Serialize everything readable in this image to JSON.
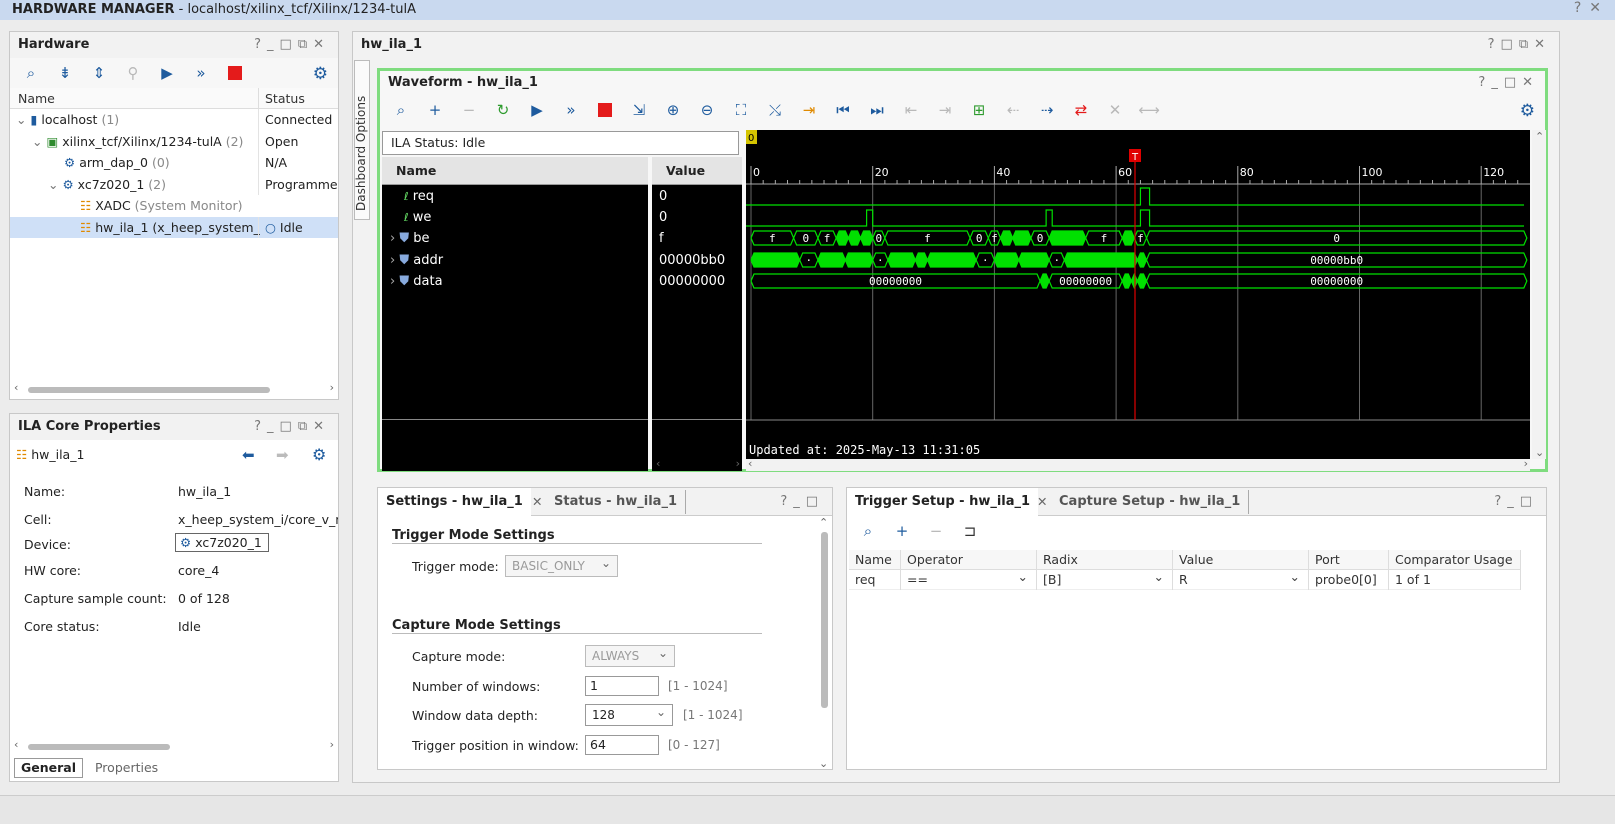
{
  "title": {
    "app": "HARDWARE MANAGER",
    "path": "localhost/xilinx_tcf/Xilinx/1234-tulA"
  },
  "hardware": {
    "title": "Hardware",
    "col_name": "Name",
    "col_status": "Status",
    "rows": [
      {
        "label": "localhost",
        "sub": "(1)",
        "status": "Connected"
      },
      {
        "label": "xilinx_tcf/Xilinx/1234-tulA",
        "sub": "(2)",
        "status": "Open"
      },
      {
        "label": "arm_dap_0",
        "sub": "(0)",
        "status": "N/A"
      },
      {
        "label": "xc7z020_1",
        "sub": "(2)",
        "status": "Programmec"
      },
      {
        "label": "XADC",
        "sub": "(System Monitor)",
        "status": ""
      },
      {
        "label": "hw_ila_1",
        "sub": "(x_heep_system_",
        "status": "Idle"
      }
    ]
  },
  "ila_props": {
    "title": "ILA Core Properties",
    "object": "hw_ila_1",
    "props": [
      {
        "k": "Name:",
        "v": "hw_ila_1"
      },
      {
        "k": "Cell:",
        "v": "x_heep_system_i/core_v_m"
      },
      {
        "k": "Device:",
        "v": "xc7z020_1"
      },
      {
        "k": "HW core:",
        "v": "core_4"
      },
      {
        "k": "Capture sample count:",
        "v": "0 of 128"
      },
      {
        "k": "Core status:",
        "v": "Idle"
      }
    ],
    "tabs": [
      "General",
      "Properties"
    ]
  },
  "main": {
    "title": "hw_ila_1",
    "side_tab": "Dashboard Options",
    "waveform": {
      "title": "Waveform - hw_ila_1",
      "ila_status": "ILA Status:  Idle",
      "col_name": "Name",
      "col_value": "Value",
      "signals": [
        {
          "name": "req",
          "value": "0"
        },
        {
          "name": "we",
          "value": "0"
        },
        {
          "name": "be",
          "value": "f"
        },
        {
          "name": "addr",
          "value": "00000bb0"
        },
        {
          "name": "data",
          "value": "00000000"
        }
      ],
      "ruler": [
        "0",
        "20",
        "40",
        "60",
        "80",
        "100",
        "120"
      ],
      "cursor_label": "T",
      "marker0": "0",
      "bus_be": [
        "f",
        "0",
        "f",
        "0",
        "f",
        "0",
        "f",
        "0",
        "f",
        "f",
        "0"
      ],
      "bus_addr": [
        "00000bb0"
      ],
      "bus_data": [
        "00000000",
        "00000000",
        "00000000"
      ],
      "updated": "Updated at: 2025-May-13 11:31:05"
    },
    "settings": {
      "tabs": [
        "Settings - hw_ila_1",
        "Status - hw_ila_1"
      ],
      "trigger_header": "Trigger Mode Settings",
      "trigger_mode_label": "Trigger mode:",
      "trigger_mode": "BASIC_ONLY",
      "capture_header": "Capture Mode Settings",
      "capture_mode_label": "Capture mode:",
      "capture_mode": "ALWAYS",
      "windows_label": "Number of windows:",
      "windows": "1",
      "windows_range": "[1 - 1024]",
      "depth_label": "Window data depth:",
      "depth": "128",
      "depth_range": "[1 - 1024]",
      "trigpos_label": "Trigger position in window:",
      "trigpos": "64",
      "trigpos_range": "[0 - 127]"
    },
    "trigger": {
      "tabs": [
        "Trigger Setup - hw_ila_1",
        "Capture Setup - hw_ila_1"
      ],
      "cols": [
        "Name",
        "Operator",
        "Radix",
        "Value",
        "Port",
        "Comparator Usage"
      ],
      "row": [
        "req",
        "==",
        "[B]",
        "R",
        "probe0[0]",
        "1 of 1"
      ]
    }
  },
  "colors": {
    "wave": "#00e000",
    "cursor": "#e00000",
    "accent": "#1e5b9e"
  }
}
